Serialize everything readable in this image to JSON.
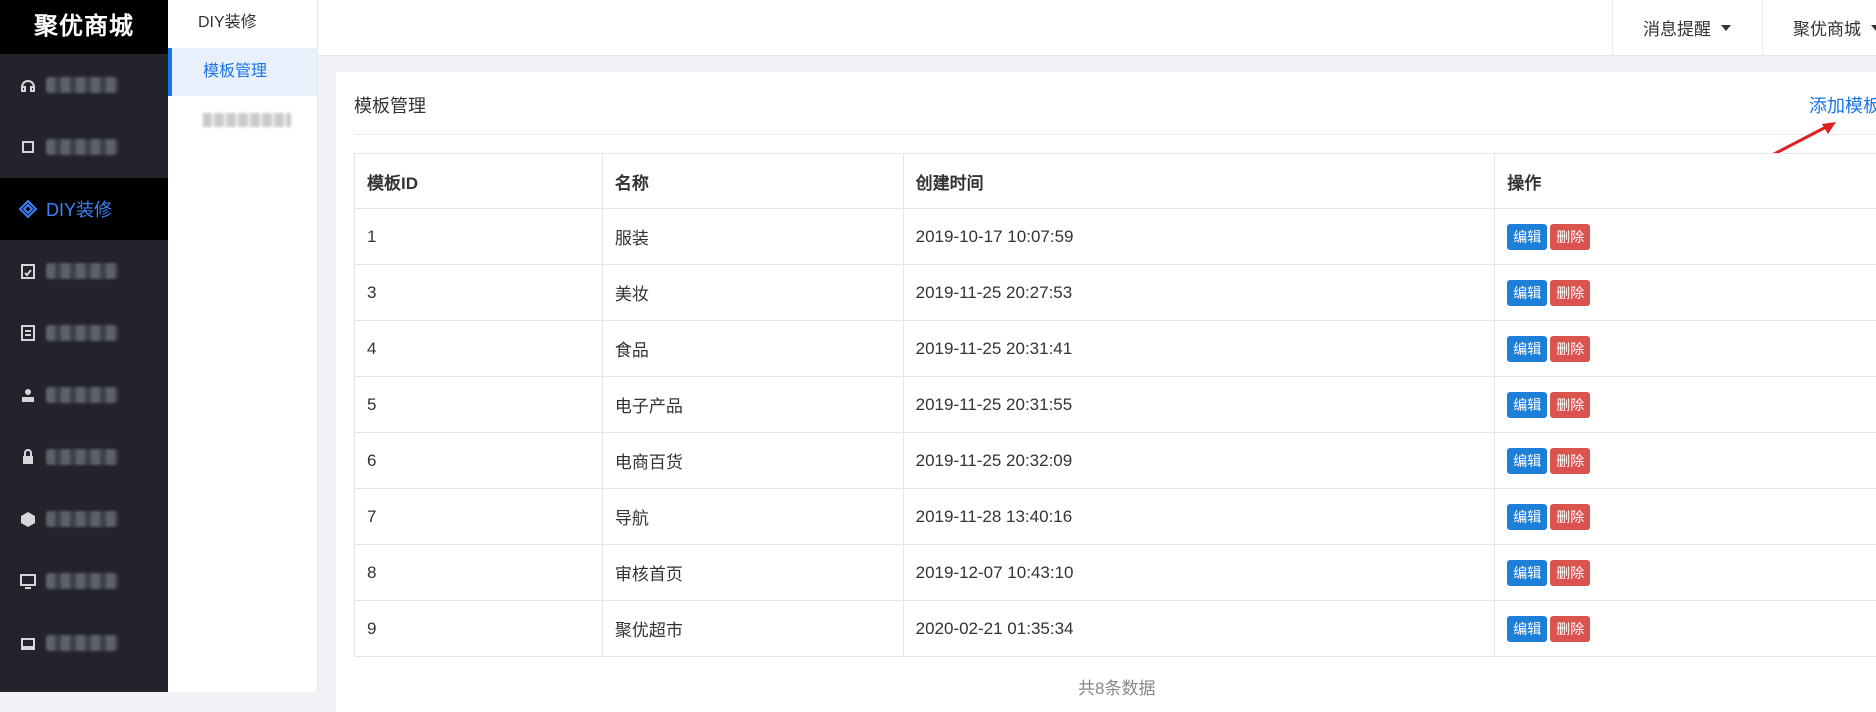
{
  "brand": "聚优商城",
  "sidebar": {
    "items": [
      {
        "label": "",
        "icon": "headset-icon",
        "blurred": true
      },
      {
        "label": "",
        "icon": "box-icon",
        "blurred": true
      },
      {
        "label": "DIY装修",
        "icon": "diy-icon",
        "blurred": false,
        "active": true
      },
      {
        "label": "",
        "icon": "report-icon",
        "blurred": true
      },
      {
        "label": "",
        "icon": "document-icon",
        "blurred": true
      },
      {
        "label": "",
        "icon": "user-manage-icon",
        "blurred": true
      },
      {
        "label": "",
        "icon": "lock-icon",
        "blurred": true
      },
      {
        "label": "",
        "icon": "cube-icon",
        "blurred": true
      },
      {
        "label": "",
        "icon": "monitor-icon",
        "blurred": true
      },
      {
        "label": "",
        "icon": "desk-icon",
        "blurred": true
      }
    ]
  },
  "subsidebar": {
    "title": "DIY装修",
    "items": [
      {
        "label": "模板管理",
        "active": true
      },
      {
        "label": "",
        "blurred": true
      }
    ]
  },
  "header": {
    "notifications": "消息提醒",
    "account": "聚优商城"
  },
  "main": {
    "title": "模板管理",
    "add_link": "添加模板",
    "columns": [
      "模板ID",
      "名称",
      "创建时间",
      "操作"
    ],
    "rows": [
      {
        "id": "1",
        "name": "服装",
        "created": "2019-10-17 10:07:59"
      },
      {
        "id": "3",
        "name": "美妆",
        "created": "2019-11-25 20:27:53"
      },
      {
        "id": "4",
        "name": "食品",
        "created": "2019-11-25 20:31:41"
      },
      {
        "id": "5",
        "name": "电子产品",
        "created": "2019-11-25 20:31:55"
      },
      {
        "id": "6",
        "name": "电商百货",
        "created": "2019-11-25 20:32:09"
      },
      {
        "id": "7",
        "name": "导航",
        "created": "2019-11-28 13:40:16"
      },
      {
        "id": "8",
        "name": "审核首页",
        "created": "2019-12-07 10:43:10"
      },
      {
        "id": "9",
        "name": "聚优超市",
        "created": "2020-02-21 01:35:34"
      }
    ],
    "edit_label": "编辑",
    "delete_label": "删除",
    "total": "共8条数据"
  },
  "colors": {
    "sidebar_bg": "#22232b",
    "active_blue": "#1a73e8",
    "edit_button": "#1e7fd8",
    "delete_button": "#d9534f",
    "annotation_arrow": "#e02020"
  }
}
